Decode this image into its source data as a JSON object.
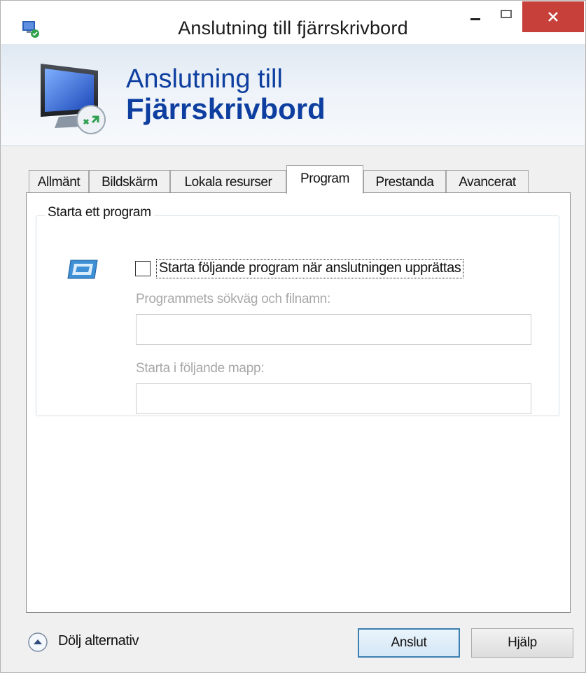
{
  "window": {
    "title": "Anslutning till fjärrskrivbord",
    "close_color": "#c7413a"
  },
  "banner": {
    "line1": "Anslutning till",
    "line2": "Fjärrskrivbord",
    "text_color": "#0e3fa0"
  },
  "tabs": [
    {
      "label": "Allmänt",
      "active": false
    },
    {
      "label": "Bildskärm",
      "active": false
    },
    {
      "label": "Lokala resurser",
      "active": false
    },
    {
      "label": "Program",
      "active": true
    },
    {
      "label": "Prestanda",
      "active": false
    },
    {
      "label": "Avancerat",
      "active": false
    }
  ],
  "program_group": {
    "legend": "Starta ett program",
    "checkbox_label": "Starta följande program när anslutningen upprättas",
    "checkbox_checked": false,
    "path_label": "Programmets sökväg och filnamn:",
    "path_value": "",
    "folder_label": "Starta i följande mapp:",
    "folder_value": ""
  },
  "footer": {
    "toggle_label": "Dölj alternativ",
    "connect_label": "Anslut",
    "help_label": "Hjälp"
  }
}
